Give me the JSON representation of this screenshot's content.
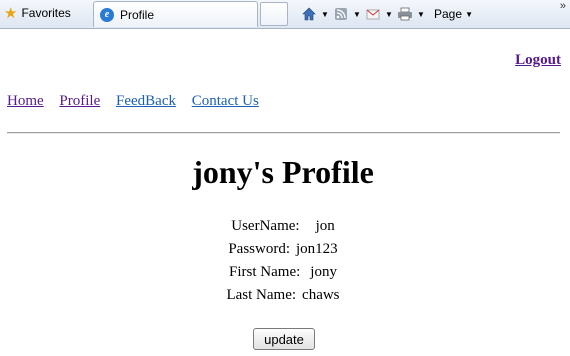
{
  "browser": {
    "favorites_label": "Favorites",
    "tab_title": "Profile",
    "page_menu_label": "Page",
    "chevron": "»"
  },
  "header": {
    "logout_label": "Logout"
  },
  "nav": {
    "items": [
      {
        "label": "Home"
      },
      {
        "label": "Profile"
      },
      {
        "label": "FeedBack"
      },
      {
        "label": "Contact Us"
      }
    ]
  },
  "profile": {
    "title": "jony's Profile",
    "fields": [
      {
        "label": "UserName:",
        "value": "jon"
      },
      {
        "label": "Password:",
        "value": "jon123"
      },
      {
        "label": "First Name:",
        "value": "jony"
      },
      {
        "label": "Last Name:",
        "value": "chaws"
      }
    ],
    "update_label": "update"
  }
}
